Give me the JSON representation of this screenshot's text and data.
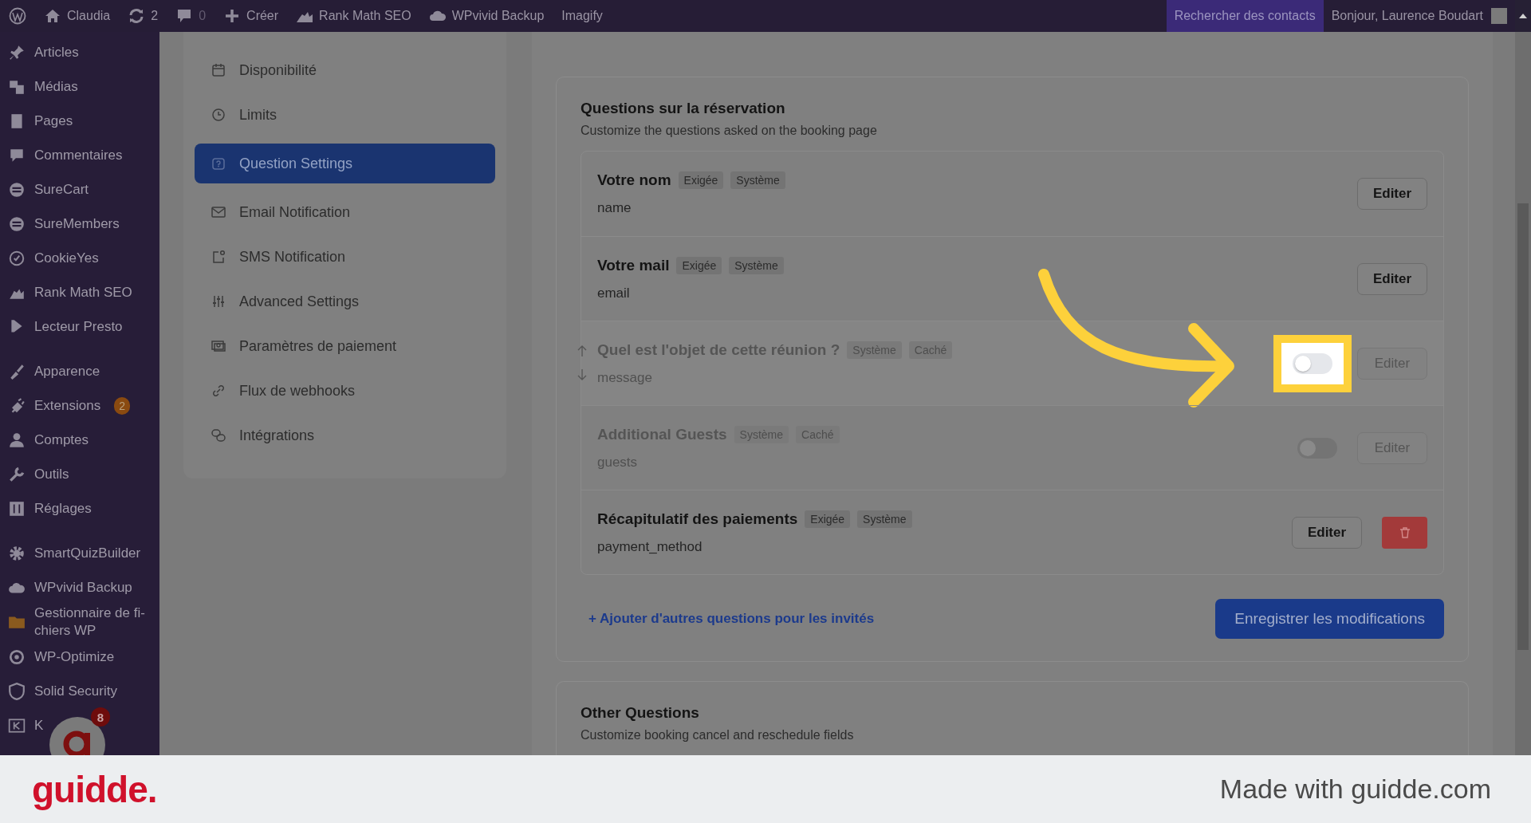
{
  "top_bar": {
    "site": "Claudia",
    "updates": "2",
    "comments": "0",
    "create": "Créer",
    "items": [
      "Rank Math SEO",
      "WPvivid Backup",
      "Imagify"
    ],
    "search_contacts": "Rechercher des contacts",
    "greeting": "Bonjour, Laurence Boudart"
  },
  "sidebar": {
    "groups": [
      [
        "Articles",
        "Médias",
        "Pages",
        "Commentaires",
        "SureCart",
        "SureMembers",
        "CookieYes",
        "Rank Math SEO",
        "Lecteur Presto"
      ],
      [
        {
          "label": "Apparence"
        },
        {
          "label": "Extensions",
          "badge": "2"
        },
        {
          "label": "Comptes"
        },
        {
          "label": "Outils"
        },
        {
          "label": "Réglages"
        }
      ],
      [
        "SmartQuizBuilder",
        "WPvivid Backup",
        "Gestionnaire de fi- chiers WP",
        "WP-Optimize",
        "Solid Security",
        "K"
      ]
    ],
    "chat_badge": "8"
  },
  "settings_nav": [
    {
      "label": "Disponibilité",
      "selected": false
    },
    {
      "label": "Limits",
      "selected": false
    },
    {
      "label": "Question Settings",
      "selected": true
    },
    {
      "label": "Email Notification",
      "selected": false
    },
    {
      "label": "SMS Notification",
      "selected": false
    },
    {
      "label": "Advanced Settings",
      "selected": false
    },
    {
      "label": "Paramètres de paiement",
      "selected": false
    },
    {
      "label": "Flux de webhooks",
      "selected": false
    },
    {
      "label": "Intégrations",
      "selected": false
    }
  ],
  "booking_questions": {
    "title": "Questions sur la réservation",
    "subtitle": "Customize the questions asked on the booking page",
    "rows": [
      {
        "kind": "fixed",
        "title": "Votre nom",
        "tags": [
          "Exigée",
          "Système"
        ],
        "field": "name",
        "hidden": false,
        "hovered": false,
        "edit": "Editer"
      },
      {
        "kind": "fixed",
        "title": "Votre mail",
        "tags": [
          "Exigée",
          "Système"
        ],
        "field": "email",
        "hidden": false,
        "hovered": false,
        "edit": "Editer"
      },
      {
        "kind": "toggle",
        "title": "Quel est l'objet de cette réunion ?",
        "tags": [
          "Système",
          "Caché"
        ],
        "field": "message",
        "hidden": true,
        "hovered": true,
        "on": false,
        "highlighted": true,
        "edit": "Editer"
      },
      {
        "kind": "toggle",
        "title": "Additional Guests",
        "tags": [
          "Système",
          "Caché"
        ],
        "field": "guests",
        "hidden": true,
        "hovered": false,
        "on": false,
        "highlighted": false,
        "edit": "Editer"
      },
      {
        "kind": "deletable",
        "title": "Récapitulatif des paiements",
        "tags": [
          "Exigée",
          "Système"
        ],
        "field": "payment_method",
        "hidden": false,
        "hovered": false,
        "edit": "Editer"
      }
    ],
    "add_link": "+ Ajouter d'autres questions pour les invités",
    "save": "Enregistrer les modifications"
  },
  "other_questions": {
    "title": "Other Questions",
    "subtitle": "Customize booking cancel and reschedule fields"
  },
  "footer": {
    "logo": "guidde.",
    "credit": "Made with guidde.com"
  }
}
